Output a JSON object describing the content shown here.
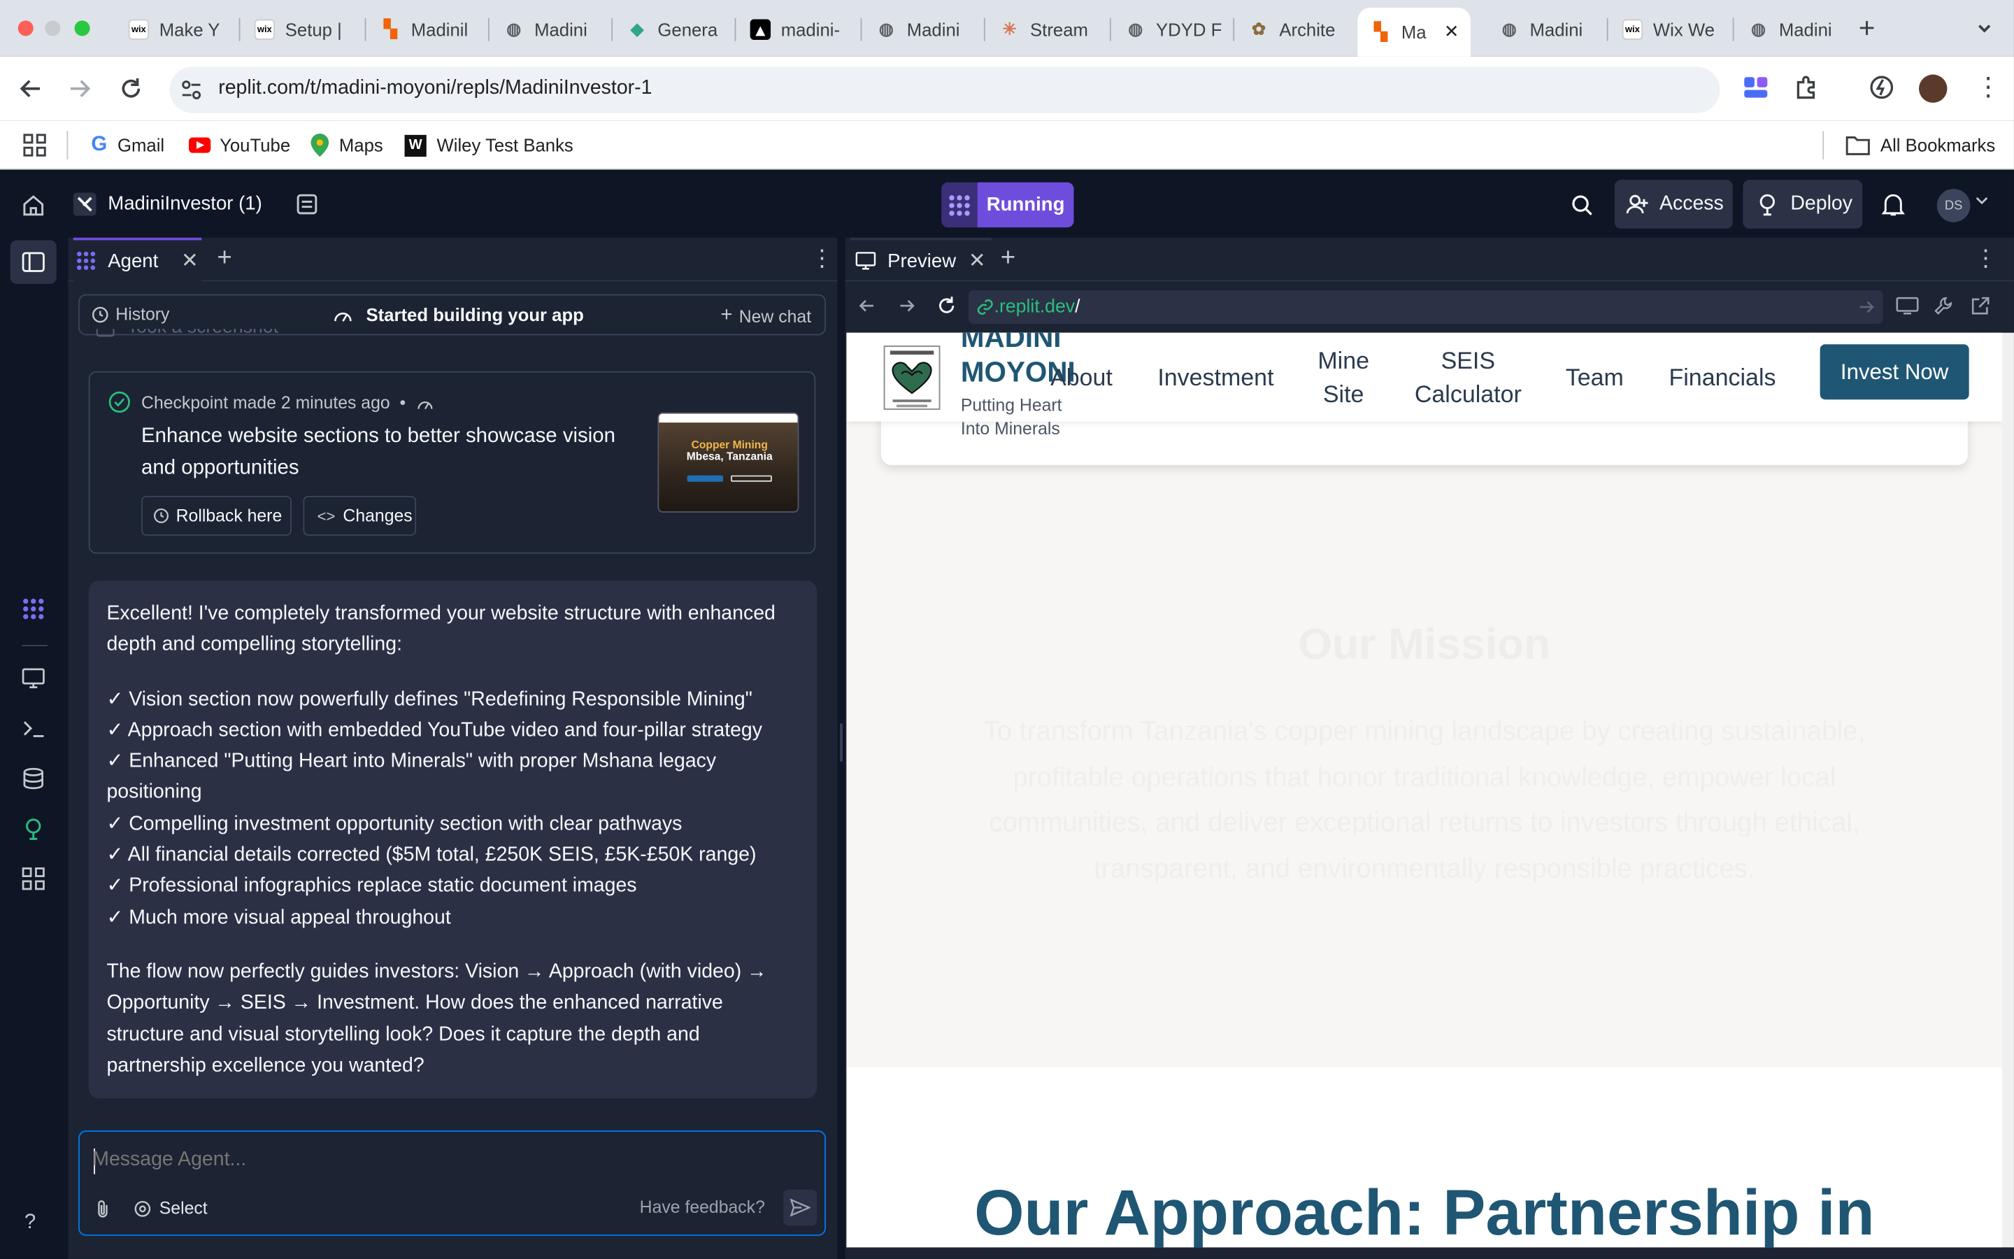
{
  "browser": {
    "tabs": [
      {
        "label": "Make Y",
        "favicon": "wix"
      },
      {
        "label": "Setup |",
        "favicon": "wix"
      },
      {
        "label": "Madinil",
        "favicon": "replit"
      },
      {
        "label": "Madini",
        "favicon": "globe"
      },
      {
        "label": "Genera",
        "favicon": "diamond"
      },
      {
        "label": "madini-",
        "favicon": "vercel"
      },
      {
        "label": "Madini",
        "favicon": "globe"
      },
      {
        "label": "Stream",
        "favicon": "claude"
      },
      {
        "label": "YDYD F",
        "favicon": "globe"
      },
      {
        "label": "Archite",
        "favicon": "arch"
      },
      {
        "label": "Ma",
        "favicon": "replit",
        "active": true
      },
      {
        "label": "Madini",
        "favicon": "globe"
      },
      {
        "label": "Wix We",
        "favicon": "wix"
      },
      {
        "label": "Madini",
        "favicon": "globe"
      }
    ],
    "url": "replit.com/t/madini-moyoni/repls/MadiniInvestor-1",
    "bookmarks": [
      "Gmail",
      "YouTube",
      "Maps",
      "Wiley Test Banks"
    ],
    "all_bookmarks": "All Bookmarks"
  },
  "replit": {
    "project_name": "MadiniInvestor (1)",
    "run_status": "Running",
    "access_label": "Access",
    "deploy_label": "Deploy",
    "avatar_initials": "DS",
    "agent_tab": "Agent",
    "history_label": "History",
    "session_title": "Started building your app",
    "new_chat_label": "New chat",
    "partial_item": "Took a screenshot",
    "checkpoint": {
      "title": "Checkpoint made",
      "time": "2 minutes ago",
      "separator": "•",
      "description": "Enhance website sections to better showcase vision and opportunities",
      "rollback_label": "Rollback here",
      "changes_label": "Changes",
      "thumb_title1": "Copper Mining",
      "thumb_title2": "Mbesa, Tanzania"
    },
    "message": {
      "intro": "Excellent! I've completely transformed your website structure with enhanced depth and compelling storytelling:",
      "points": [
        "✓ Vision section now powerfully defines \"Redefining Responsible Mining\"",
        "✓ Approach section with embedded YouTube video and four-pillar strategy",
        "✓ Enhanced \"Putting Heart into Minerals\" with proper Mshana legacy positioning",
        "✓ Compelling investment opportunity section with clear pathways",
        "✓ All financial details corrected ($5M total, £250K SEIS, £5K-£50K range)",
        "✓ Professional infographics replace static document images",
        "✓ Much more visual appeal throughout"
      ],
      "outro": "The flow now perfectly guides investors: Vision → Approach (with video) → Opportunity → SEIS → Investment. How does the enhanced narrative structure and visual storytelling look? Does it capture the depth and partnership excellence you wanted?"
    },
    "input_placeholder": "Message Agent...",
    "select_label": "Select",
    "feedback_label": "Have feedback?",
    "help_label": "?",
    "preview_tab": "Preview",
    "preview_url_domain": ".replit.dev",
    "preview_url_path": "/"
  },
  "site": {
    "brand_line1": "MADINI",
    "brand_line2": "MOYONI",
    "tagline_line1": "Putting Heart",
    "tagline_line2": "Into Minerals",
    "nav": [
      {
        "line1": "About"
      },
      {
        "line1": "Investment"
      },
      {
        "line1": "Mine",
        "line2": "Site"
      },
      {
        "line1": "SEIS",
        "line2": "Calculator"
      },
      {
        "line1": "Team"
      },
      {
        "line1": "Financials"
      }
    ],
    "cta": "Invest Now",
    "mission_title": "Our Mission",
    "mission_text": "To transform Tanzania's copper mining landscape by creating sustainable, profitable operations that honor traditional knowledge, empower local communities, and deliver exceptional returns to investors through ethical, transparent, and environmentally responsible practices.",
    "approach_title": "Our Approach: Partnership in",
    "accent": "#1f5673"
  },
  "colors": {
    "replit_bg": "#0e1525",
    "panel": "#1c2333",
    "bubble": "#2b3045",
    "running": "#6e4ddd",
    "chrome_tabstrip": "#dee3ea"
  }
}
